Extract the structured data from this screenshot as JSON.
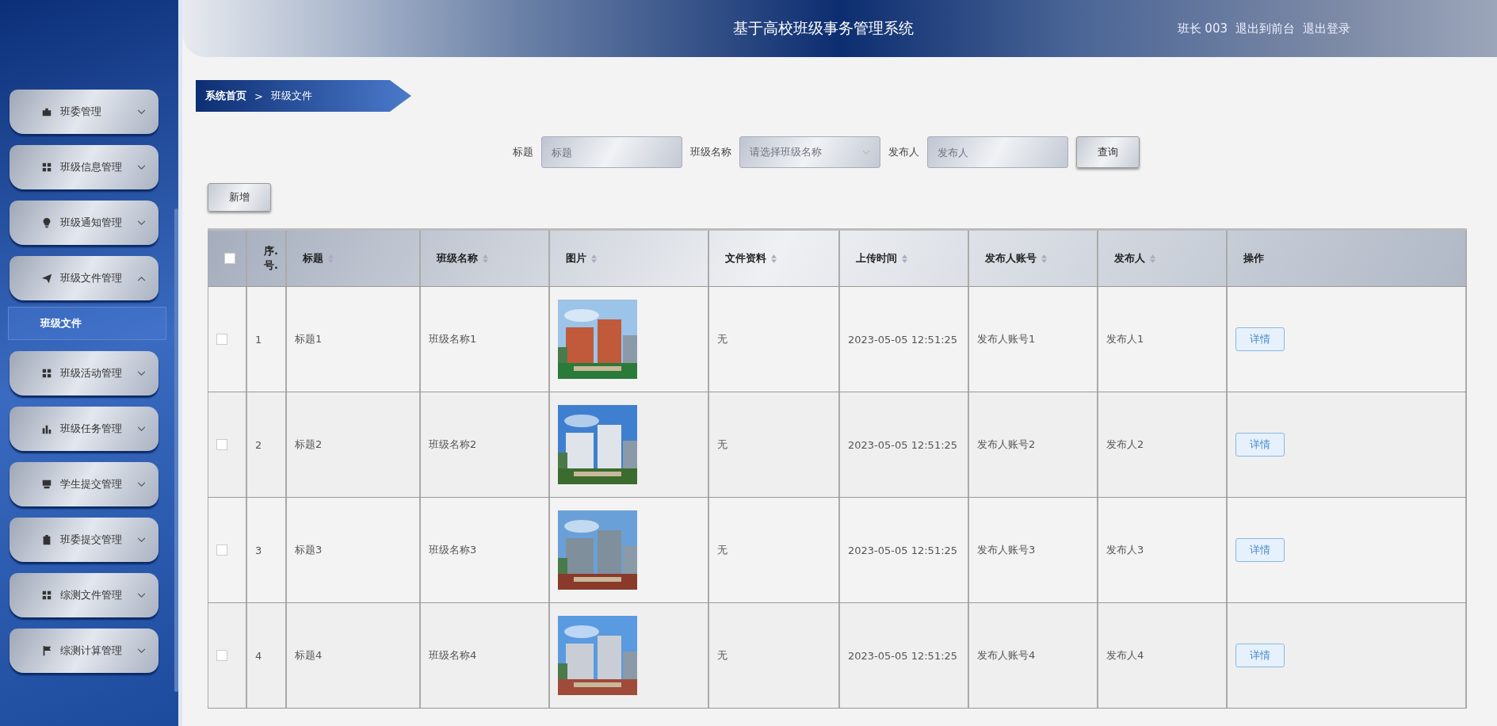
{
  "header": {
    "title": "基于高校班级事务管理系统",
    "user": "班长 003",
    "links": [
      "退出到前台",
      "退出登录"
    ]
  },
  "sidebar": {
    "items": [
      {
        "label": "班委管理",
        "expanded": false
      },
      {
        "label": "班级信息管理",
        "expanded": false
      },
      {
        "label": "班级通知管理",
        "expanded": false
      },
      {
        "label": "班级文件管理",
        "expanded": true,
        "children": [
          {
            "label": "班级文件",
            "selected": true
          }
        ]
      },
      {
        "label": "班级活动管理",
        "expanded": false
      },
      {
        "label": "班级任务管理",
        "expanded": false
      },
      {
        "label": "学生提交管理",
        "expanded": false
      },
      {
        "label": "班委提交管理",
        "expanded": false
      },
      {
        "label": "综测文件管理",
        "expanded": false
      },
      {
        "label": "综测计算管理",
        "expanded": false
      }
    ]
  },
  "breadcrumb": [
    "系统首页",
    "班级文件"
  ],
  "breadcrumb_separator": ">",
  "search": {
    "fields": [
      {
        "label": "标题",
        "kind": "text",
        "placeholder": "标题"
      },
      {
        "label": "班级名称",
        "kind": "select",
        "placeholder": "请选择班级名称"
      },
      {
        "label": "发布人",
        "kind": "text",
        "placeholder": "发布人"
      }
    ],
    "button": "查询"
  },
  "add_button": "新增",
  "table": {
    "header_checked": false,
    "columns": [
      {
        "kind": "checkbox",
        "sortable": false
      },
      {
        "label": "序.号.",
        "kind": "index",
        "sortable": false
      },
      {
        "label": "标题",
        "kind": "text",
        "sortable": true
      },
      {
        "label": "班级名称",
        "kind": "text",
        "sortable": true
      },
      {
        "label": "图片",
        "kind": "picture",
        "sortable": true
      },
      {
        "label": "文件资料",
        "kind": "text",
        "sortable": true
      },
      {
        "label": "上传时间",
        "kind": "text",
        "sortable": true
      },
      {
        "label": "发布人账号",
        "kind": "text",
        "sortable": true
      },
      {
        "label": "发布人",
        "kind": "text",
        "sortable": true
      },
      {
        "label": "操作",
        "kind": "action",
        "sortable": false
      }
    ],
    "rows": [
      {
        "checked": false,
        "index": "1",
        "title": "标题1",
        "class_name": "班级名称1",
        "file": "无",
        "time": "2023-05-05 12:51:25",
        "account": "发布人账号1",
        "publisher": "发布人1",
        "action": "详情"
      },
      {
        "checked": false,
        "index": "2",
        "title": "标题2",
        "class_name": "班级名称2",
        "file": "无",
        "time": "2023-05-05 12:51:25",
        "account": "发布人账号2",
        "publisher": "发布人2",
        "action": "详情"
      },
      {
        "checked": false,
        "index": "3",
        "title": "标题3",
        "class_name": "班级名称3",
        "file": "无",
        "time": "2023-05-05 12:51:25",
        "account": "发布人账号3",
        "publisher": "发布人3",
        "action": "详情"
      },
      {
        "checked": false,
        "index": "4",
        "title": "标题4",
        "class_name": "班级名称4",
        "file": "无",
        "time": "2023-05-05 12:51:25",
        "account": "发布人账号4",
        "publisher": "发布人4",
        "action": "详情"
      }
    ]
  }
}
